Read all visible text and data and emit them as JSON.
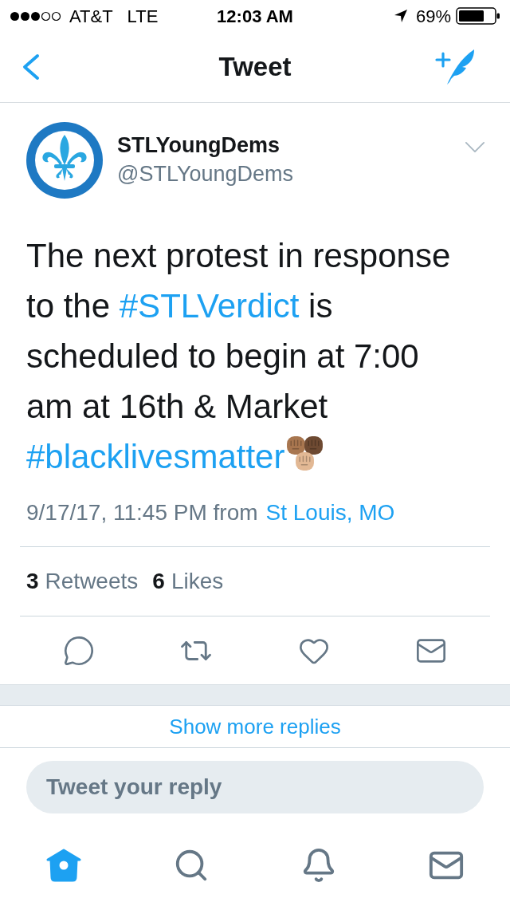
{
  "status_bar": {
    "carrier": "AT&T",
    "network": "LTE",
    "time": "12:03 AM",
    "battery": "69%"
  },
  "nav": {
    "title": "Tweet"
  },
  "tweet": {
    "author_name": "STLYoungDems",
    "handle": "@STLYoungDems",
    "text": [
      {
        "kind": "text",
        "text": "The next protest in response to the "
      },
      {
        "kind": "hashtag",
        "text": "#STLVerdict"
      },
      {
        "kind": "text",
        "text": " is scheduled to begin at 7:00 am at 16th & Market "
      },
      {
        "kind": "hashtag",
        "text": "#blacklivesmatter"
      }
    ],
    "emoji": [
      {
        "color": "#a8764f"
      },
      {
        "color": "#6e4a32"
      },
      {
        "color": "#e2b894"
      }
    ],
    "timestamp": "9/17/17, 11:45 PM from",
    "location": "St Louis, MO",
    "stats": [
      {
        "count": "3",
        "label": "Retweets"
      },
      {
        "count": "6",
        "label": "Likes"
      }
    ]
  },
  "show_more": "Show more replies",
  "reply_field": {
    "placeholder": "Tweet your reply"
  },
  "tab_bar": [
    {
      "selected": true
    },
    {
      "selected": false
    },
    {
      "selected": false
    },
    {
      "selected": false
    }
  ]
}
